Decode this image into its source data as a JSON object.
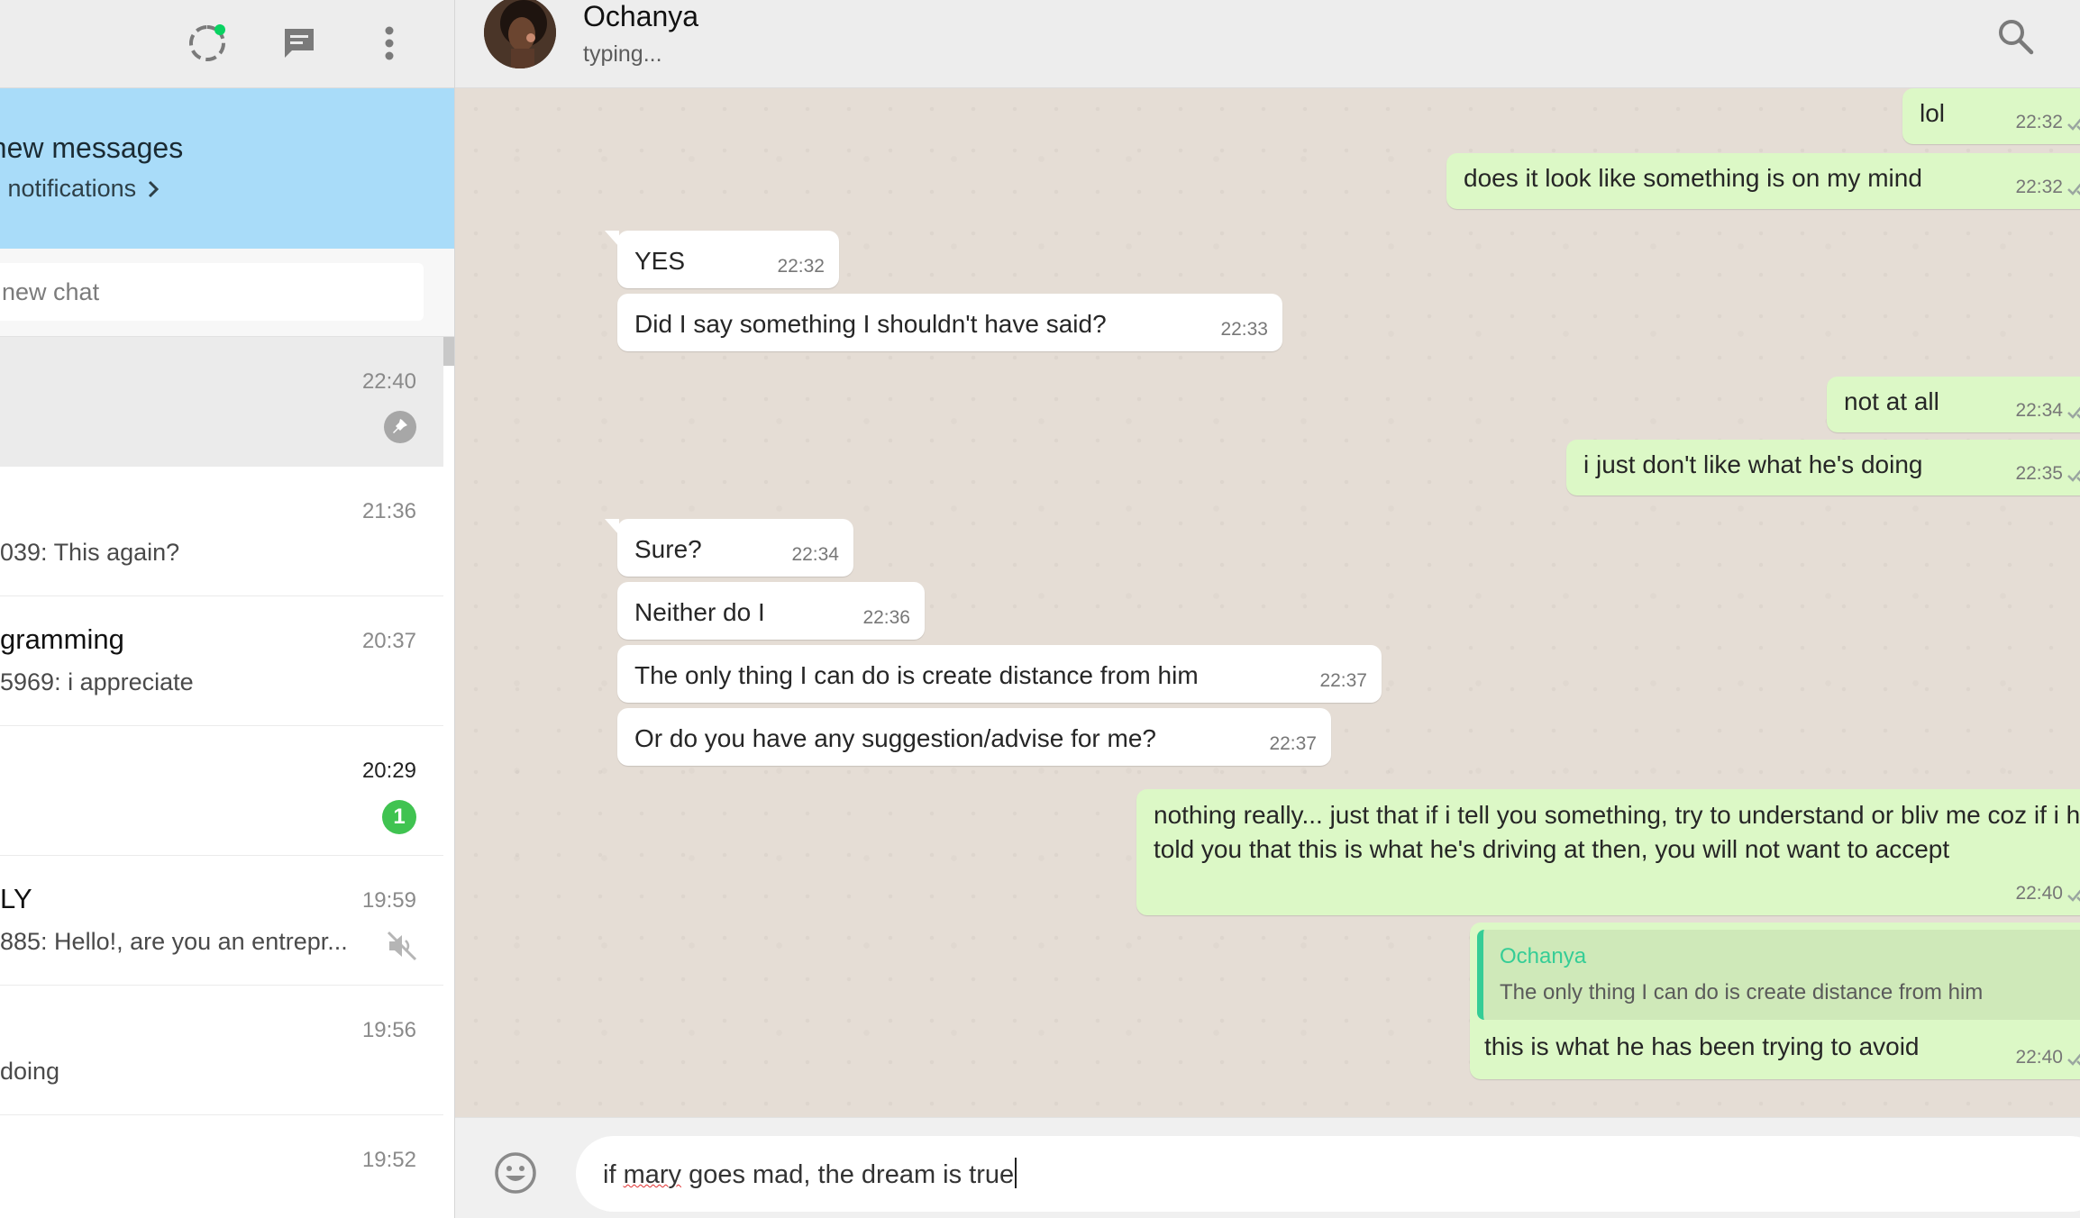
{
  "sidebar": {
    "banner": {
      "title": "f new messages",
      "link": "o notifications"
    },
    "search": {
      "placeholder": "new chat"
    },
    "chats": [
      {
        "name": "",
        "preview": "",
        "time": "22:40",
        "indicator": "pinned"
      },
      {
        "name": "",
        "preview": "039: This again?",
        "time": "21:36",
        "indicator": ""
      },
      {
        "name": "gramming",
        "preview": "5969: i appreciate",
        "time": "20:37",
        "indicator": ""
      },
      {
        "name": "",
        "preview": "",
        "time": "20:29",
        "indicator": "unread",
        "unread_count": "1"
      },
      {
        "name": "LY",
        "preview": "885: Hello!, are you an entrepr...",
        "time": "19:59",
        "indicator": "muted"
      },
      {
        "name": "",
        "preview": "doing",
        "time": "19:56",
        "indicator": ""
      },
      {
        "name": "",
        "preview": "",
        "time": "19:52",
        "indicator": ""
      }
    ]
  },
  "conversation": {
    "contact_name": "Ochanya",
    "contact_status": "typing...",
    "messages": [
      {
        "dir": "out",
        "text": "lol",
        "time": "22:32"
      },
      {
        "dir": "out",
        "text": "does it look like something is on my mind",
        "time": "22:32"
      },
      {
        "dir": "in",
        "text": "YES",
        "time": "22:32"
      },
      {
        "dir": "in",
        "text": "Did I say something I shouldn't have said?",
        "time": "22:33"
      },
      {
        "dir": "out",
        "text": "not at all",
        "time": "22:34"
      },
      {
        "dir": "out",
        "text": "i just don't like what he's doing",
        "time": "22:35"
      },
      {
        "dir": "in",
        "text": "Sure?",
        "time": "22:34"
      },
      {
        "dir": "in",
        "text": "Neither do I",
        "time": "22:36"
      },
      {
        "dir": "in",
        "text": "The only thing I can do is create distance from him",
        "time": "22:37"
      },
      {
        "dir": "in",
        "text": "Or do you have any suggestion/advise for me?",
        "time": "22:37"
      },
      {
        "dir": "out",
        "text": "nothing really... just that if i tell you something, try to understand or bliv me coz if i had told you that this is what he's driving at then, you will not want to accept",
        "time": "22:40"
      },
      {
        "dir": "out",
        "text": "this is what he has been trying to avoid",
        "time": "22:40",
        "quote_author": "Ochanya",
        "quote_text": "The only thing I can do is create distance from him"
      }
    ]
  },
  "composer": {
    "text_before": "if ",
    "misspelled": "mary",
    "text_after": " goes mad, the dream is true"
  },
  "colors": {
    "outgoing_bubble": "#dcf8c6",
    "incoming_bubble": "#ffffff",
    "banner": "#a9dcf9",
    "unread_badge": "#40c351",
    "read_ticks": "#4fc3f7",
    "quote_accent": "#35cd96"
  },
  "icons": [
    "status-icon",
    "new-chat-icon",
    "menu-icon",
    "chevron-right-icon",
    "pin-icon",
    "mute-icon",
    "search-icon",
    "emoji-icon",
    "double-check-icon"
  ]
}
